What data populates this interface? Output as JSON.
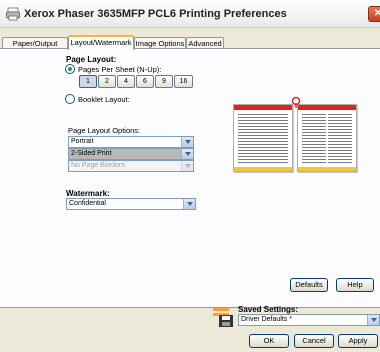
{
  "window": {
    "title": "Xerox Phaser 3635MFP PCL6 Printing Preferences",
    "app_icon": "printer-icon",
    "close_glyph": "✕"
  },
  "tabs": [
    {
      "label": "Paper/Output"
    },
    {
      "label": "Layout/Watermark",
      "active": true
    },
    {
      "label": "Image Options"
    },
    {
      "label": "Advanced"
    }
  ],
  "page_layout": {
    "heading": "Page Layout:",
    "pages_per_sheet_label": "Pages Per Sheet (N-Up):",
    "nup_options": [
      "1",
      "2",
      "4",
      "6",
      "9",
      "16"
    ],
    "nup_selected": "1",
    "booklet_label": "Booklet Layout:"
  },
  "page_layout_options": {
    "label": "Page Layout Options:",
    "orientation": "Portrait",
    "sided": "2-Sided Print",
    "borders": "No Page Borders"
  },
  "watermark": {
    "heading": "Watermark:",
    "value": "Confidential"
  },
  "buttons": {
    "defaults": "Defaults",
    "help": "Help",
    "ok": "OK",
    "cancel": "Cancel",
    "apply": "Apply"
  },
  "saved_settings": {
    "label": "Saved Settings:",
    "value": "Driver Defaults *"
  },
  "colors": {
    "tab_accent": "#f7b44a",
    "preview_red": "#e0261c",
    "preview_yellow": "#f0c83c"
  }
}
